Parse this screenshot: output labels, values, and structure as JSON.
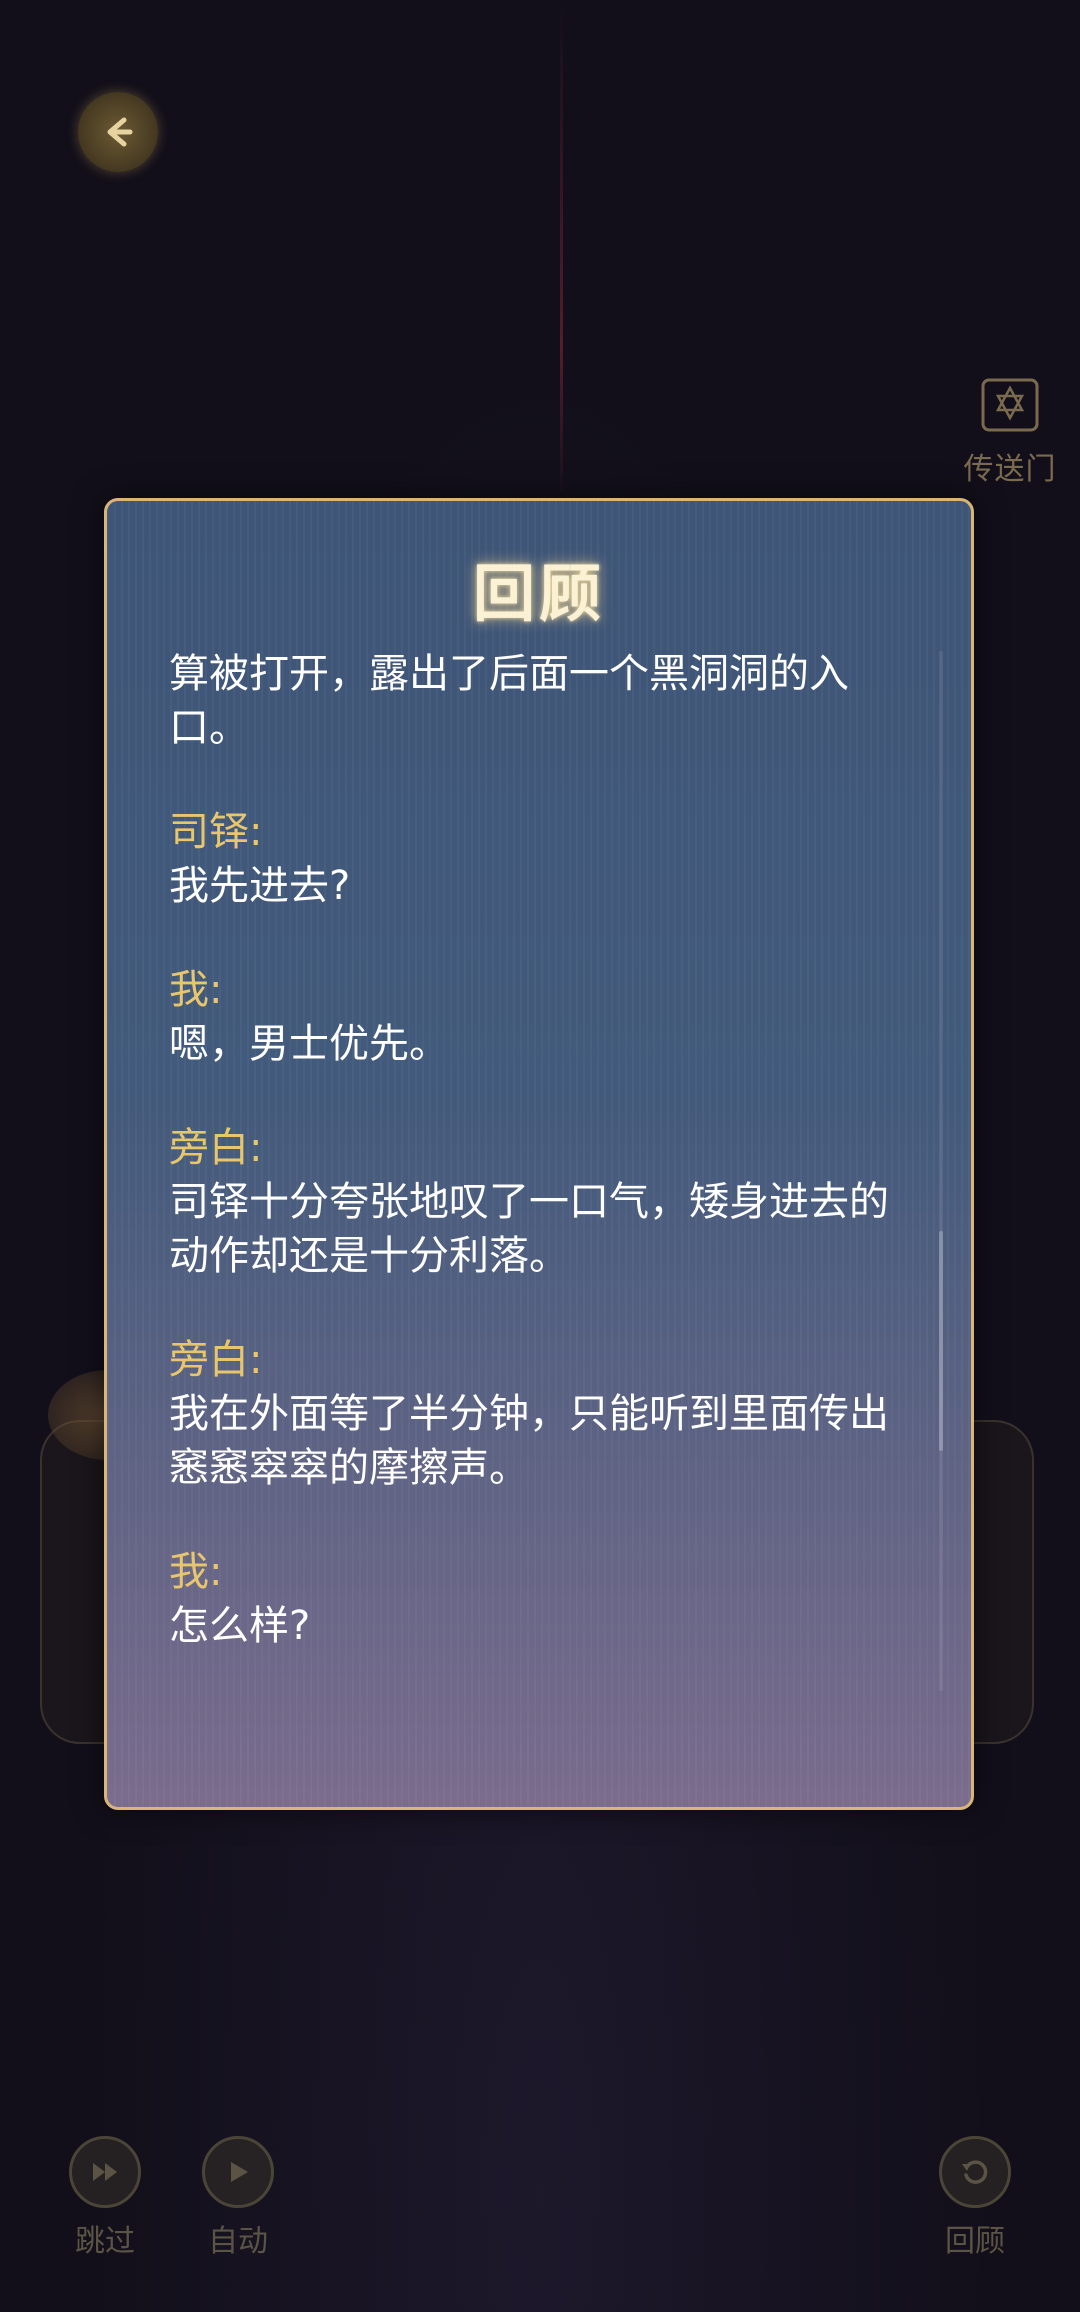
{
  "top": {
    "back_icon": "back-arrow-icon",
    "portal_label": "传送门"
  },
  "dialog": {
    "title": "回顾",
    "entries": [
      {
        "speaker": "",
        "text": "算被打开，露出了后面一个黑洞洞的入口。"
      },
      {
        "speaker": "司铎:",
        "text": "我先进去?"
      },
      {
        "speaker": "我:",
        "text": "嗯，男士优先。"
      },
      {
        "speaker": "旁白:",
        "text": "司铎十分夸张地叹了一口气，矮身进去的动作却还是十分利落。"
      },
      {
        "speaker": "旁白:",
        "text": "我在外面等了半分钟，只能听到里面传出窸窸窣窣的摩擦声。"
      },
      {
        "speaker": "我:",
        "text": "怎么样?"
      }
    ]
  },
  "controls": {
    "skip_label": "跳过",
    "auto_label": "自动",
    "review_label": "回顾"
  },
  "colors": {
    "accent_gold": "#d9b676",
    "speaker": "#e8c66d",
    "panel": "#425a7b"
  }
}
